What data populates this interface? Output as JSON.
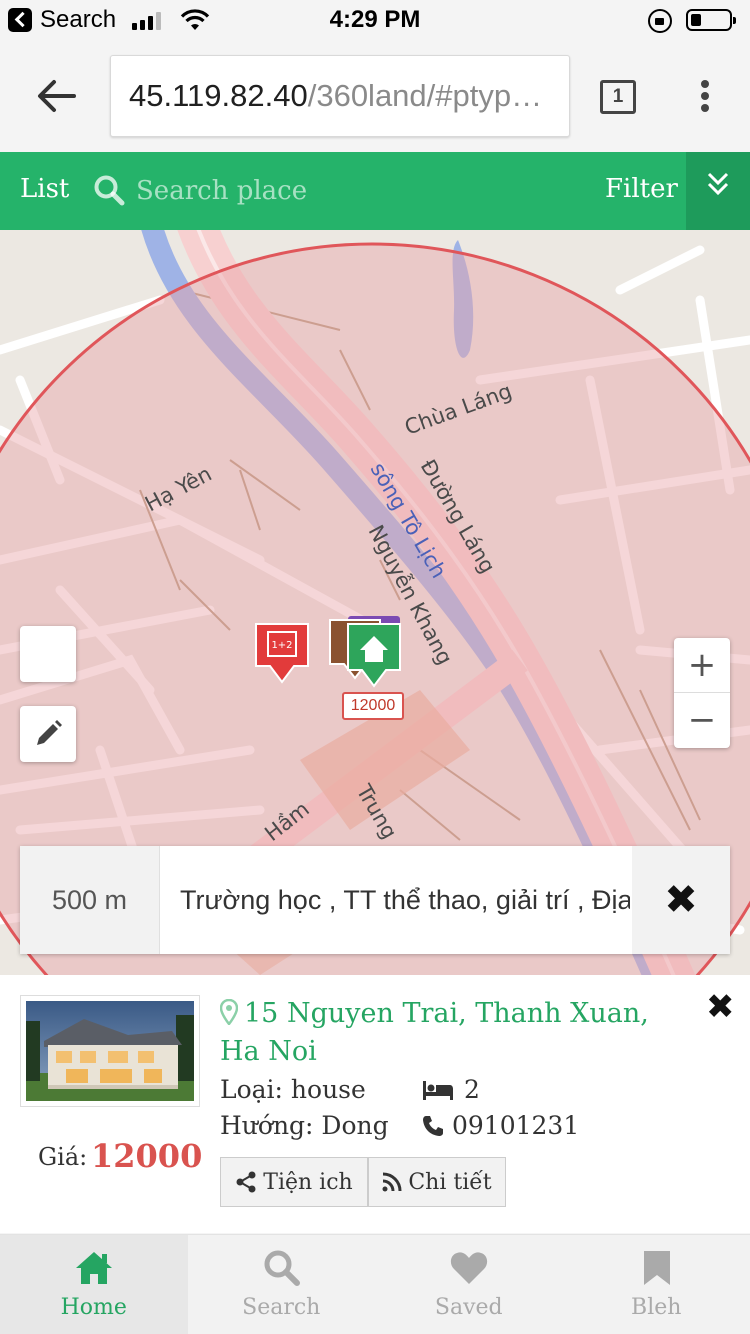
{
  "status_bar": {
    "back_app_label": "Search",
    "time": "4:29 PM"
  },
  "browser": {
    "url_host": "45.119.82.40",
    "url_path": "/360land/#ptyp…",
    "tab_count": "1"
  },
  "app_bar": {
    "list_label": "List",
    "search_placeholder": "Search place",
    "filter_label": "Filter"
  },
  "map": {
    "labels": {
      "road_chua_lang": "Chùa Láng",
      "road_duong_lang": "Đường Láng",
      "river_to_lich": "sông Tô Lịch",
      "road_nguyen_khang": "Nguyễn Khang",
      "area_ha_yen": "Hạ Yên",
      "road_ham": "Hầm",
      "road_trung": "Trung"
    },
    "marker_price": "12000",
    "zoom_in": "+",
    "zoom_out": "−"
  },
  "info_bar": {
    "radius": "500 m",
    "categories": "Trường học , TT thể thao, giải trí , Địa",
    "close": "✖"
  },
  "listing": {
    "address": "15 Nguyen Trai, Thanh Xuan, Ha Noi",
    "type_label": "Loại: house",
    "beds": "2",
    "direction_label": "Hướng: Dong",
    "phone": "09101231",
    "price_label": "Giá:",
    "price_value": "12000",
    "amenities_btn": "Tiện ich",
    "detail_btn": "Chi tiết",
    "close": "✖"
  },
  "bottom_nav": {
    "items": [
      {
        "label": "Home",
        "icon": "home-icon",
        "active": true
      },
      {
        "label": "Search",
        "icon": "search-icon",
        "active": false
      },
      {
        "label": "Saved",
        "icon": "heart-icon",
        "active": false
      },
      {
        "label": "Bleh",
        "icon": "bookmark-icon",
        "active": false
      }
    ]
  },
  "colors": {
    "brand_green": "#25b36a",
    "price_red": "#d9534f",
    "link_green": "#25a562",
    "radius_fill": "#e8b3b3",
    "radius_stroke": "#e0565a"
  }
}
